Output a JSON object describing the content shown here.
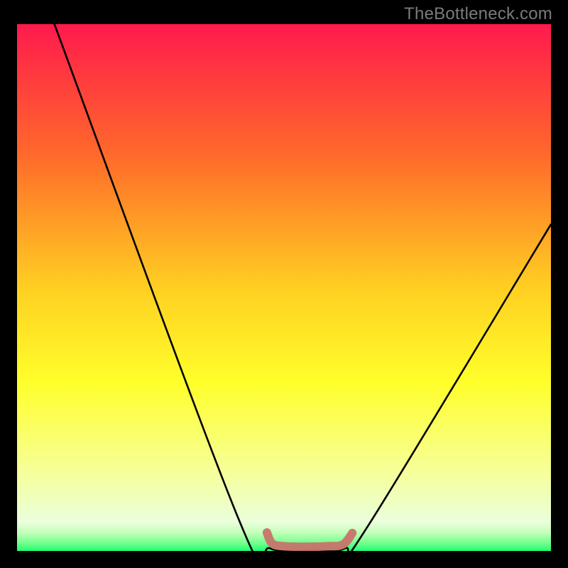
{
  "watermark": {
    "text": "TheBottleneck.com"
  },
  "chart_data": {
    "type": "line",
    "title": "",
    "xlabel": "",
    "ylabel": "",
    "xlim": [
      0,
      1
    ],
    "ylim": [
      0,
      1
    ],
    "grid": false,
    "background": {
      "type": "vertical-gradient",
      "stops": [
        {
          "pos": 0.0,
          "color": "#ff1a4d"
        },
        {
          "pos": 0.25,
          "color": "#ff6a2a"
        },
        {
          "pos": 0.5,
          "color": "#ffcf22"
        },
        {
          "pos": 0.68,
          "color": "#ffff2a"
        },
        {
          "pos": 0.85,
          "color": "#f6ff99"
        },
        {
          "pos": 0.945,
          "color": "#eaffdc"
        },
        {
          "pos": 0.965,
          "color": "#c5ffb9"
        },
        {
          "pos": 0.986,
          "color": "#6fff8a"
        },
        {
          "pos": 1.0,
          "color": "#1dff73"
        }
      ]
    },
    "series": [
      {
        "name": "bottleneck-curve",
        "color": "#000000",
        "stroke_width": 2.6,
        "points": [
          {
            "x": 0.07,
            "y": 1.0
          },
          {
            "x": 0.414,
            "y": 0.063
          },
          {
            "x": 0.474,
            "y": 0.005
          },
          {
            "x": 0.552,
            "y": 0.002
          },
          {
            "x": 0.614,
            "y": 0.005
          },
          {
            "x": 0.662,
            "y": 0.055
          },
          {
            "x": 1.0,
            "y": 0.62
          }
        ]
      },
      {
        "name": "trough-highlight",
        "color": "#c9736d",
        "stroke_width": 12,
        "stroke_linecap": "round",
        "points": [
          {
            "x": 0.468,
            "y": 0.035
          },
          {
            "x": 0.478,
            "y": 0.014
          },
          {
            "x": 0.5,
            "y": 0.009
          },
          {
            "x": 0.54,
            "y": 0.008
          },
          {
            "x": 0.58,
            "y": 0.009
          },
          {
            "x": 0.61,
            "y": 0.012
          },
          {
            "x": 0.628,
            "y": 0.034
          }
        ]
      }
    ]
  }
}
